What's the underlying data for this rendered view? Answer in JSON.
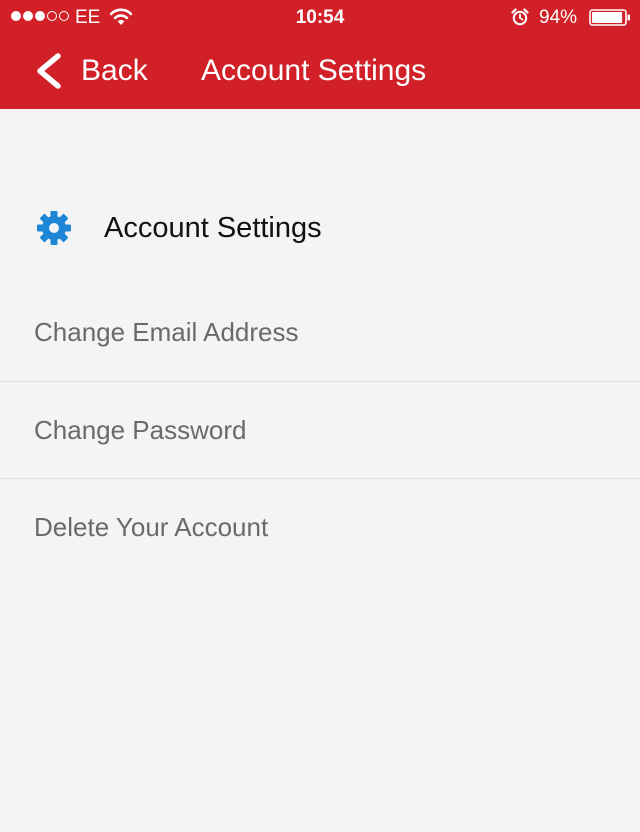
{
  "status_bar": {
    "carrier": "EE",
    "time": "10:54",
    "battery": "94%",
    "battery_level": 0.94,
    "signal_strength": 3,
    "signal_max": 5
  },
  "nav": {
    "back_label": "Back",
    "title": "Account Settings"
  },
  "section": {
    "icon": "gear-icon",
    "title": "Account Settings"
  },
  "menu": {
    "items": [
      {
        "label": "Change Email Address"
      },
      {
        "label": "Change Password"
      },
      {
        "label": "Delete Your Account"
      }
    ]
  },
  "colors": {
    "header_red": "#d12027",
    "background": "#f4f4f4",
    "gear_blue": "#1d86d6",
    "menu_text": "#6a6a6a"
  }
}
